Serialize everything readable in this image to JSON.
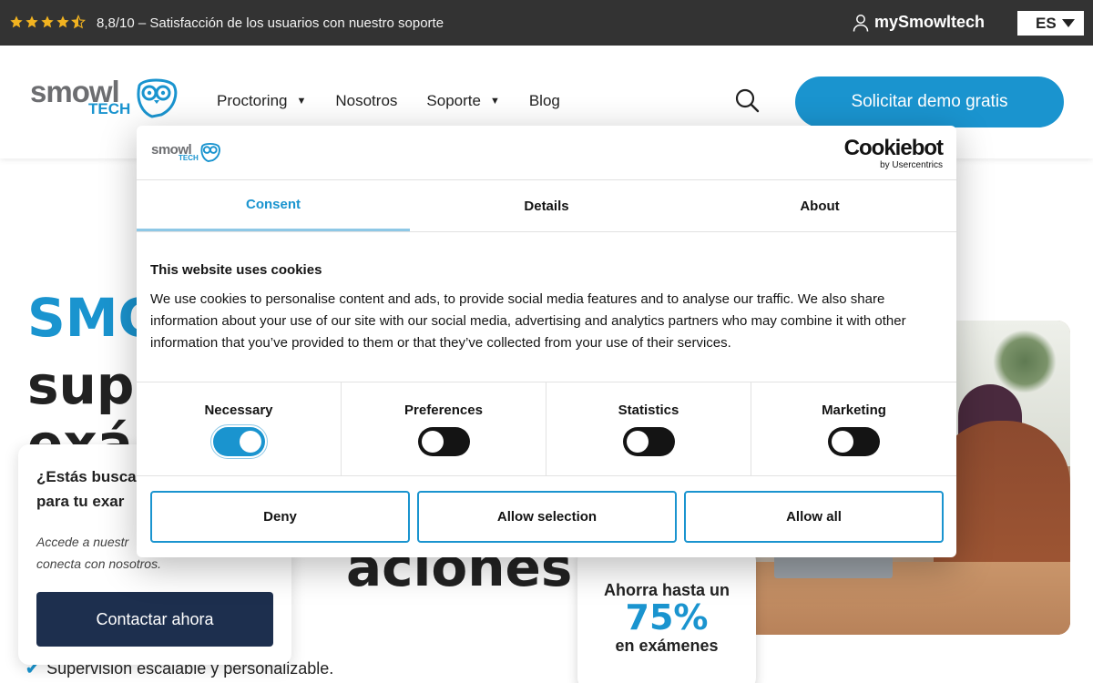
{
  "topbar": {
    "rating_text": "8,8/10 – Satisfacción de los usuarios con nuestro soporte",
    "rating_stars": 4.5,
    "star_color": "#f2b320",
    "account_label": "mySmowltech",
    "language": "ES"
  },
  "header": {
    "logo": {
      "word": "smowl",
      "sub": "TECH"
    },
    "nav": [
      {
        "label": "Proctoring",
        "dropdown": true
      },
      {
        "label": "Nosotros",
        "dropdown": false
      },
      {
        "label": "Soporte",
        "dropdown": true
      },
      {
        "label": "Blog",
        "dropdown": false
      }
    ],
    "caret": "▼",
    "demo_button": "Solicitar demo gratis"
  },
  "hero": {
    "line1": "SMO",
    "line2": "sup",
    "line3": "exár",
    "line6": "aciones",
    "bullet_tail": ".",
    "bullet": "Supervisión escalable y personalizable.",
    "check": "✔"
  },
  "savings": {
    "line1": "Ahorra hasta un",
    "value": "75%",
    "line3": "en exámenes"
  },
  "contact": {
    "title": "¿Estás busca\npara tu exar",
    "text": "Accede a nuestr\nconecta con nosotros.",
    "button": "Contactar ahora"
  },
  "cookie": {
    "logo": {
      "word": "smowl",
      "sub": "TECH"
    },
    "brand_name": "Cookiebot",
    "brand_sub": "by Usercentrics",
    "tabs": [
      "Consent",
      "Details",
      "About"
    ],
    "active_tab": 0,
    "heading": "This website uses cookies",
    "text": "We use cookies to personalise content and ads, to provide social media features and to analyse our traffic. We also share information about your use of our site with our social media, advertising and analytics partners who may combine it with other information that you’ve provided to them or that they’ve collected from your use of their services.",
    "toggles": [
      {
        "label": "Necessary",
        "on": true
      },
      {
        "label": "Preferences",
        "on": false
      },
      {
        "label": "Statistics",
        "on": false
      },
      {
        "label": "Marketing",
        "on": false
      }
    ],
    "buttons": [
      "Deny",
      "Allow selection",
      "Allow all"
    ]
  },
  "colors": {
    "brand_blue": "#1a94cf",
    "dark_navy": "#1d2f4e",
    "topbar_bg": "#333333"
  }
}
